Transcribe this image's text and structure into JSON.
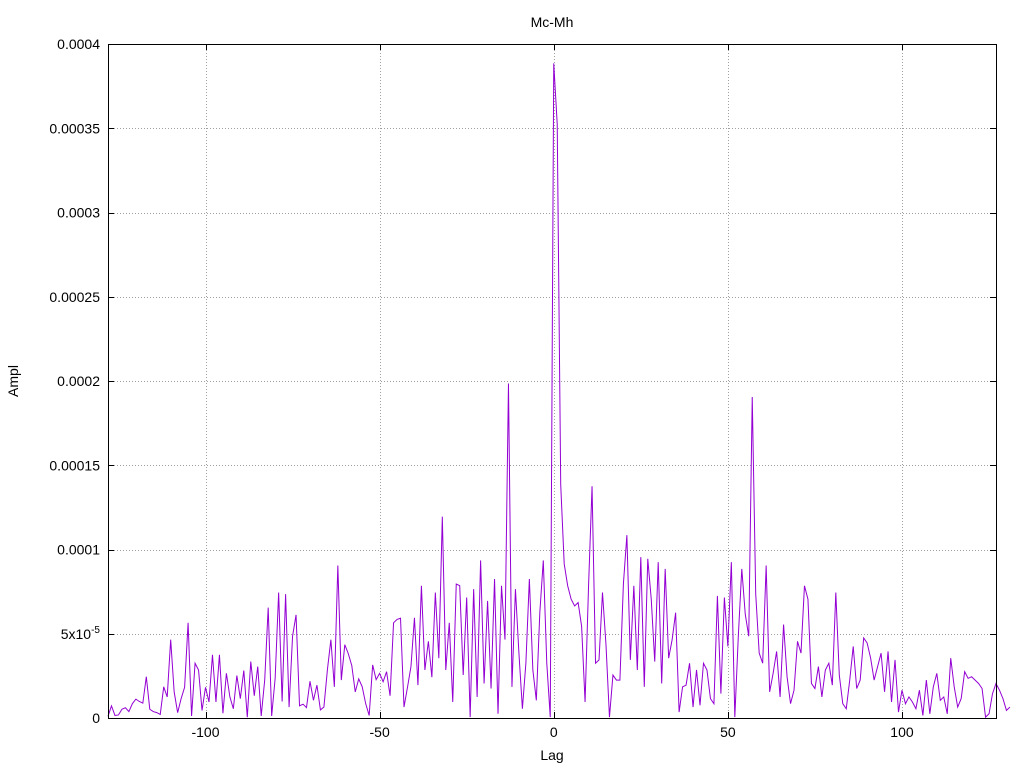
{
  "chart_data": {
    "type": "line",
    "title": "Mc-Mh",
    "xlabel": "Lag",
    "ylabel": "Ampl",
    "xlim": [
      -128,
      127
    ],
    "ylim": [
      0,
      0.0004
    ],
    "grid": true,
    "x_ticks": [
      {
        "value": -100,
        "label": "-100"
      },
      {
        "value": -50,
        "label": "-50"
      },
      {
        "value": 0,
        "label": "0"
      },
      {
        "value": 50,
        "label": "50"
      },
      {
        "value": 100,
        "label": "100"
      }
    ],
    "y_ticks": [
      {
        "value": 0,
        "label": "0"
      },
      {
        "value": 5e-05,
        "label": "5x10",
        "sup": "-5"
      },
      {
        "value": 0.0001,
        "label": "0.0001"
      },
      {
        "value": 0.00015,
        "label": "0.00015"
      },
      {
        "value": 0.0002,
        "label": "0.0002"
      },
      {
        "value": 0.00025,
        "label": "0.00025"
      },
      {
        "value": 0.0003,
        "label": "0.0003"
      },
      {
        "value": 0.00035,
        "label": "0.00035"
      },
      {
        "value": 0.0004,
        "label": "0.0004"
      }
    ],
    "series_color": "#9400d3",
    "series": [
      {
        "x_start": -128,
        "x_step": 1,
        "values": [
          1e-06,
          7.2e-06,
          1.5e-06,
          1.8e-06,
          5.2e-06,
          6.1e-06,
          3.8e-06,
          8.5e-06,
          1.12e-05,
          9.8e-06,
          8.8e-06,
          2.45e-05,
          5.2e-06,
          3.8e-06,
          3.2e-06,
          2.1e-06,
          1.85e-05,
          1.25e-05,
          4.65e-05,
          1.55e-05,
          3.2e-06,
          1.15e-05,
          1.82e-05,
          5.65e-05,
          1.2e-06,
          3.25e-05,
          2.85e-05,
          4.5e-06,
          1.82e-05,
          9.5e-06,
          3.75e-05,
          9.5e-06,
          3.75e-05,
          2.8e-06,
          2.65e-05,
          1.25e-05,
          5.5e-06,
          2.52e-05,
          1.15e-05,
          2.82e-05,
          5e-07,
          3.35e-05,
          1.32e-05,
          3.05e-05,
          1.2e-06,
          2.25e-05,
          6.55e-05,
          1.2e-06,
          2.35e-05,
          7.45e-05,
          9.8e-06,
          7.35e-05,
          6.5e-06,
          4.85e-05,
          6.12e-05,
          7.2e-06,
          8.2e-06,
          6.2e-06,
          2.18e-05,
          1.05e-05,
          1.95e-05,
          4.8e-06,
          6.5e-06,
          2.85e-05,
          4.65e-05,
          1.85e-05,
          9.05e-05,
          2.25e-05,
          4.35e-05,
          3.82e-05,
          3.12e-05,
          1.55e-05,
          2.32e-05,
          1.85e-05,
          8.5e-06,
          1.5e-06,
          3.15e-05,
          2.28e-05,
          2.65e-05,
          2.15e-05,
          2.75e-05,
          1.32e-05,
          5.65e-05,
          5.85e-05,
          5.92e-05,
          6.5e-06,
          1.82e-05,
          3.05e-05,
          5.95e-05,
          1.95e-05,
          7.85e-05,
          2.85e-05,
          4.55e-05,
          2.42e-05,
          7.45e-05,
          3.55e-05,
          0.0001195,
          2.85e-05,
          5.65e-05,
          9.5e-06,
          7.95e-05,
          7.85e-05,
          2.55e-05,
          7.15e-05,
          5e-07,
          7.65e-05,
          1.25e-05,
          9.35e-05,
          2.05e-05,
          6.95e-05,
          1.75e-05,
          8.25e-05,
          2.5e-06,
          7.85e-05,
          4.65e-05,
          0.0001985,
          1.85e-05,
          7.65e-05,
          3.85e-05,
          5.5e-06,
          3.25e-05,
          8.25e-05,
          2.85e-05,
          1.05e-05,
          6.25e-05,
          9.35e-05,
          3.25e-05,
          5e-07,
          0.0003885,
          0.0003525,
          0.0001385,
          9.15e-05,
          7.85e-05,
          7.05e-05,
          6.65e-05,
          6.85e-05,
          5.45e-05,
          9.5e-06,
          7.85e-05,
          0.0001375,
          3.25e-05,
          3.45e-05,
          7.45e-05,
          4.35e-05,
          5e-07,
          2.55e-05,
          2.25e-05,
          2.25e-05,
          7.95e-05,
          0.0001085,
          3.45e-05,
          7.85e-05,
          2.85e-05,
          9.55e-05,
          1.85e-05,
          9.45e-05,
          7.05e-05,
          3.35e-05,
          9.25e-05,
          2.05e-05,
          8.85e-05,
          3.55e-05,
          4.65e-05,
          6.25e-05,
          3.5e-06,
          1.85e-05,
          1.95e-05,
          3.25e-05,
          6.5e-06,
          2.85e-05,
          7.5e-06,
          3.25e-05,
          2.85e-05,
          1.15e-05,
          8.5e-06,
          7.25e-05,
          1.45e-05,
          7.15e-05,
          4.25e-05,
          9.25e-05,
          5e-07,
          4.85e-05,
          8.85e-05,
          6.15e-05,
          4.85e-05,
          0.0001905,
          7.35e-05,
          3.85e-05,
          3.25e-05,
          9.05e-05,
          1.55e-05,
          2.65e-05,
          3.95e-05,
          1.25e-05,
          5.55e-05,
          2.45e-05,
          8.5e-06,
          1.65e-05,
          4.55e-05,
          3.85e-05,
          7.85e-05,
          7.05e-05,
          2.05e-05,
          1.75e-05,
          3.05e-05,
          1.25e-05,
          2.85e-05,
          3.25e-05,
          1.95e-05,
          7.45e-05,
          2.55e-05,
          8.5e-06,
          5.5e-06,
          2.25e-05,
          4.25e-05,
          1.75e-05,
          2.25e-05,
          4.75e-05,
          4.45e-05,
          3.55e-05,
          2.25e-05,
          3.05e-05,
          3.85e-05,
          1.55e-05,
          3.95e-05,
          9.5e-06,
          3.45e-05,
          3.5e-06,
          1.65e-05,
          8.5e-06,
          1.25e-05,
          9.5e-06,
          5.5e-06,
          1.65e-05,
          1.5e-06,
          2.25e-05,
          2.5e-06,
          1.85e-05,
          2.65e-05,
          1.05e-05,
          1.25e-05,
          2.5e-06,
          3.55e-05,
          1.85e-05,
          6.5e-06,
          1.15e-05,
          2.75e-05,
          2.35e-05,
          2.45e-05,
          2.25e-05,
          2.05e-05,
          1.75e-05,
          5e-07,
          2.5e-06,
          1.45e-05,
          2.05e-05,
          1.65e-05,
          1.15e-05,
          4.5e-06,
          6.5e-06
        ]
      }
    ]
  }
}
